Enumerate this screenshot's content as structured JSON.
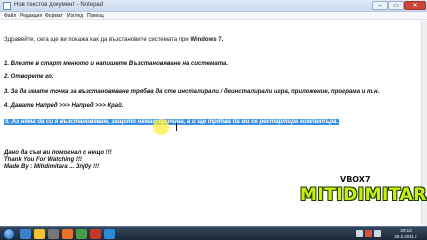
{
  "window": {
    "title": "Нов текстов документ - Notepad",
    "min_label": "–",
    "max_label": "▭",
    "close_label": "✕"
  },
  "menu": [
    {
      "label": "Файл"
    },
    {
      "label": "Редакция"
    },
    {
      "label": "Формат"
    },
    {
      "label": "Изглед"
    },
    {
      "label": "Помощ"
    }
  ],
  "content": {
    "intro_prefix": "Здравейте, сега ще ви покажа как да възстановите системата при ",
    "intro_em": "Windows 7.",
    "step1": "1. Влезте в старт менюто и напишете Възстановяване на системата.",
    "step2": "2. Отворете го.",
    "step3": "3. За да имате точка за възстановяване трябва да сте инсталирали / деинсталирали игра, приложение, програма и т.н.",
    "step4": "4. Давате Напред >>> Напред >>> Край.",
    "step5": "5. Аз няма да си я възстановявам, защото нямам причина, а и ще трябва да ми се рестартира компютъра.",
    "outro1": "Дано да съм ви помогнал с нещо !!!",
    "outro2": "Thank You For Watching !!!",
    "outro3": "Made By : Mitidimitara ... 3nj0y !!!"
  },
  "watermark": {
    "small": "VBOX7",
    "big": "MITIDIMITARA"
  },
  "taskbar": {
    "clock_time": "20:13",
    "clock_date": "26.2.2011 г."
  }
}
